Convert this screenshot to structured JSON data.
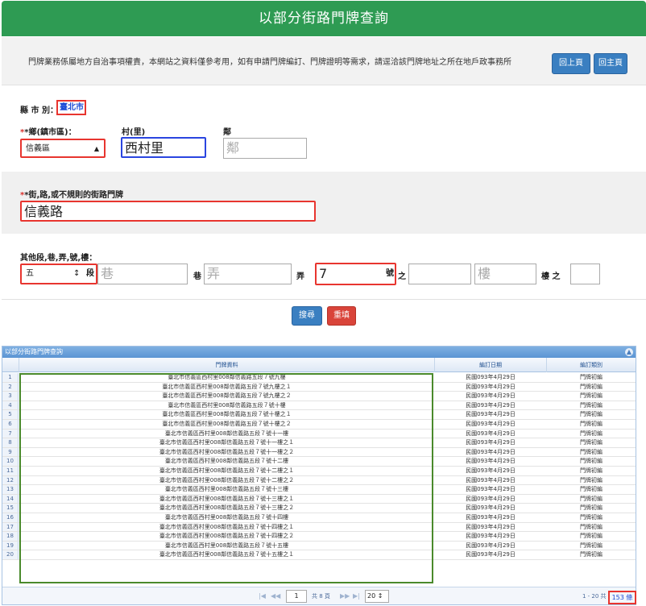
{
  "header": {
    "title": "以部分街路門牌查詢"
  },
  "notice": {
    "text": "門牌業務係屬地方自治事項權責，本網站之資料僅參考用，如有申請門牌編訂、門牌證明等需求，請逕洽該門牌地址之所在地戶政事務所",
    "back_label": "回上頁",
    "home_label": "回主頁"
  },
  "form": {
    "county_label": "縣 市 別：",
    "county_value": "臺北市",
    "township_label": "*鄉(鎮市區)：",
    "township_value": "信義區",
    "village_label": "村(里)",
    "village_value": "西村里",
    "neighborhood_label": "鄰",
    "neighborhood_placeholder": "鄰",
    "street_label": "*街,路,或不規則的街路門牌",
    "street_value": "信義路",
    "others_label": "其他段,巷,弄,號,樓：",
    "section_value": "五",
    "section_label": "段",
    "lane_placeholder": "巷",
    "lane_label": "巷",
    "alley_placeholder": "弄",
    "alley_label": "弄",
    "number_value": "7",
    "number_label": "號",
    "zhi_label": "之",
    "floor_placeholder": "樓",
    "floor_label": "樓 之",
    "search_label": "搜尋",
    "reset_label": "重填"
  },
  "grid": {
    "title": "以部分街路門牌查詢",
    "columns": [
      "門牌資料",
      "編訂日期",
      "編訂類別"
    ],
    "rows": [
      {
        "num": "1",
        "addr": "臺北市信義區西村里008鄰信義路五段７號九樓",
        "date": "民國093年4月29日",
        "type": "門牌初編"
      },
      {
        "num": "2",
        "addr": "臺北市信義區西村里008鄰信義路五段７號九樓之１",
        "date": "民國093年4月29日",
        "type": "門牌初編"
      },
      {
        "num": "3",
        "addr": "臺北市信義區西村里008鄰信義路五段７號九樓之２",
        "date": "民國093年4月29日",
        "type": "門牌初編"
      },
      {
        "num": "4",
        "addr": "臺北市信義區西村里008鄰信義路五段７號十樓",
        "date": "民國093年4月29日",
        "type": "門牌初編"
      },
      {
        "num": "5",
        "addr": "臺北市信義區西村里008鄰信義路五段７號十樓之１",
        "date": "民國093年4月29日",
        "type": "門牌初編"
      },
      {
        "num": "6",
        "addr": "臺北市信義區西村里008鄰信義路五段７號十樓之２",
        "date": "民國093年4月29日",
        "type": "門牌初編"
      },
      {
        "num": "7",
        "addr": "臺北市信義區西村里008鄰信義路五段７號十一樓",
        "date": "民國093年4月29日",
        "type": "門牌初編"
      },
      {
        "num": "8",
        "addr": "臺北市信義區西村里008鄰信義路五段７號十一樓之１",
        "date": "民國093年4月29日",
        "type": "門牌初編"
      },
      {
        "num": "9",
        "addr": "臺北市信義區西村里008鄰信義路五段７號十一樓之２",
        "date": "民國093年4月29日",
        "type": "門牌初編"
      },
      {
        "num": "10",
        "addr": "臺北市信義區西村里008鄰信義路五段７號十二樓",
        "date": "民國093年4月29日",
        "type": "門牌初編"
      },
      {
        "num": "11",
        "addr": "臺北市信義區西村里008鄰信義路五段７號十二樓之１",
        "date": "民國093年4月29日",
        "type": "門牌初編"
      },
      {
        "num": "12",
        "addr": "臺北市信義區西村里008鄰信義路五段７號十二樓之２",
        "date": "民國093年4月29日",
        "type": "門牌初編"
      },
      {
        "num": "13",
        "addr": "臺北市信義區西村里008鄰信義路五段７號十三樓",
        "date": "民國093年4月29日",
        "type": "門牌初編"
      },
      {
        "num": "14",
        "addr": "臺北市信義區西村里008鄰信義路五段７號十三樓之１",
        "date": "民國093年4月29日",
        "type": "門牌初編"
      },
      {
        "num": "15",
        "addr": "臺北市信義區西村里008鄰信義路五段７號十三樓之２",
        "date": "民國093年4月29日",
        "type": "門牌初編"
      },
      {
        "num": "16",
        "addr": "臺北市信義區西村里008鄰信義路五段７號十四樓",
        "date": "民國093年4月29日",
        "type": "門牌初編"
      },
      {
        "num": "17",
        "addr": "臺北市信義區西村里008鄰信義路五段７號十四樓之１",
        "date": "民國093年4月29日",
        "type": "門牌初編"
      },
      {
        "num": "18",
        "addr": "臺北市信義區西村里008鄰信義路五段７號十四樓之２",
        "date": "民國093年4月29日",
        "type": "門牌初編"
      },
      {
        "num": "19",
        "addr": "臺北市信義區西村里008鄰信義路五段７號十五樓",
        "date": "民國093年4月29日",
        "type": "門牌初編"
      },
      {
        "num": "20",
        "addr": "臺北市信義區西村里008鄰信義路五段７號十五樓之１",
        "date": "民國093年4月29日",
        "type": "門牌初編"
      }
    ]
  },
  "pager": {
    "page_value": "1",
    "total_pages_text": "共 8 頁",
    "page_size": "20",
    "range_text": "1 - 20 共",
    "total_text": "153 條"
  },
  "colors": {
    "header_green": "#2e9b53",
    "button_blue": "#3a7fc1",
    "button_red": "#d9443a",
    "highlight_red": "#e8352f",
    "highlight_blue": "#2a45e0",
    "highlight_green": "#4a8a2c"
  }
}
